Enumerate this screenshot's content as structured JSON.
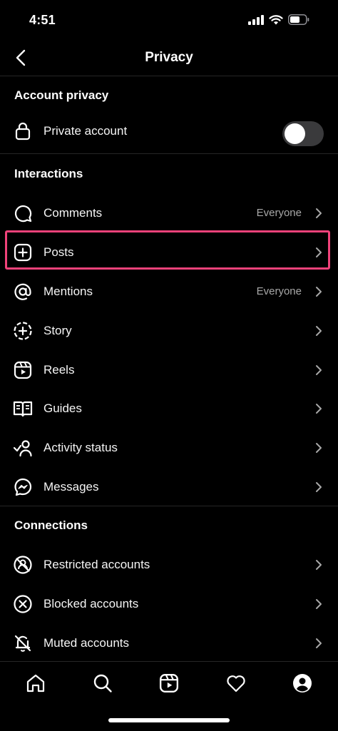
{
  "status_bar": {
    "time": "4:51"
  },
  "nav": {
    "title": "Privacy"
  },
  "sections": {
    "account_privacy": "Account privacy",
    "interactions": "Interactions",
    "connections": "Connections"
  },
  "account": {
    "private_label": "Private account",
    "private_enabled": false
  },
  "interactions": [
    {
      "label": "Comments",
      "value": "Everyone",
      "icon": "comment-icon"
    },
    {
      "label": "Posts",
      "value": "",
      "icon": "add-post-icon"
    },
    {
      "label": "Mentions",
      "value": "Everyone",
      "icon": "mention-icon"
    },
    {
      "label": "Story",
      "value": "",
      "icon": "story-icon"
    },
    {
      "label": "Reels",
      "value": "",
      "icon": "reels-icon"
    },
    {
      "label": "Guides",
      "value": "",
      "icon": "guides-icon"
    },
    {
      "label": "Activity status",
      "value": "",
      "icon": "activity-status-icon"
    },
    {
      "label": "Messages",
      "value": "",
      "icon": "messenger-icon"
    }
  ],
  "connections": [
    {
      "label": "Restricted accounts",
      "icon": "restricted-icon"
    },
    {
      "label": "Blocked accounts",
      "icon": "blocked-icon"
    },
    {
      "label": "Muted accounts",
      "icon": "muted-icon"
    }
  ],
  "tabs": [
    "home-icon",
    "search-icon",
    "reels-icon",
    "heart-icon",
    "profile-icon"
  ],
  "colors": {
    "background": "#000000",
    "highlight": "#f0427a",
    "secondary_text": "#a8a8a8",
    "toggle_off": "#3a3a3c"
  }
}
